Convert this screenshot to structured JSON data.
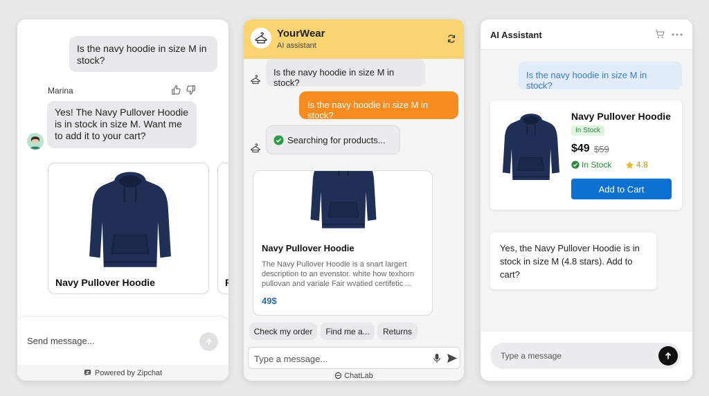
{
  "panel1": {
    "user_message": "Is the navy hoodie in size M in stock?",
    "agent_name": "Marina",
    "bot_message": "Yes! The Navy Pullover Hoodie is in stock in size M. Want me to add it to your cart?",
    "product_card": {
      "title": "Navy Pullover Hoodie"
    },
    "product_card_next": {
      "title": "P"
    },
    "composer_placeholder": "Send message...",
    "footer_text": "Powered by Zipchat",
    "icons": {
      "like": "thumbs-up-icon",
      "dislike": "thumbs-down-icon",
      "send": "arrow-up-icon",
      "brand": "zipchat-icon"
    }
  },
  "panel2": {
    "brand_name": "YourWear",
    "brand_subtitle": "AI assistant",
    "bot_question": "Is the navy hoodie in size M in stock?",
    "user_message": "Is the navy hoodie in size M in stock?",
    "searching_text": "Searching for products...",
    "product_card": {
      "title": "Navy Pullover Hoodie",
      "description": "The Navy Pullover Hoodie is a snart largert description to an evenstor. white how texhorn pullovan and variale Fair wvatied certifetic ...",
      "price": "49$"
    },
    "quick_replies": [
      "Check my order",
      "Find me a...",
      "Returns"
    ],
    "input_placeholder": "Type a message...",
    "footer_text": "ChatLab",
    "colors": {
      "header": "#f9d470",
      "user_bubble": "#f68b1f",
      "price": "#2b6aa6"
    },
    "icons": {
      "logo": "hanger-icon",
      "refresh": "refresh-icon",
      "mic": "mic-icon",
      "send": "send-icon",
      "check": "check-circle-icon"
    }
  },
  "panel3": {
    "header_title": "AI Assistant",
    "user_message": "Is the navy hoodie in size M in stock?",
    "product_card": {
      "title": "Navy Pullover Hoodie",
      "badge": "In Stock",
      "price": "$49",
      "old_price": "$59",
      "stock_text": "In Stock",
      "rating": "4.8",
      "button_label": "Add to Cart"
    },
    "bot_message": "Yes, the Navy Pullover Hoodie is in stock in size M (4.8 stars). Add to cart?",
    "input_placeholder": "Type a message",
    "colors": {
      "button": "#0b72d4",
      "user_bubble": "#e1ecf8",
      "stock": "#2c8a3a",
      "star": "#f0b51f"
    },
    "icons": {
      "cart": "cart-icon",
      "more": "more-dots-icon",
      "send": "arrow-up-icon",
      "star": "star-icon"
    }
  }
}
